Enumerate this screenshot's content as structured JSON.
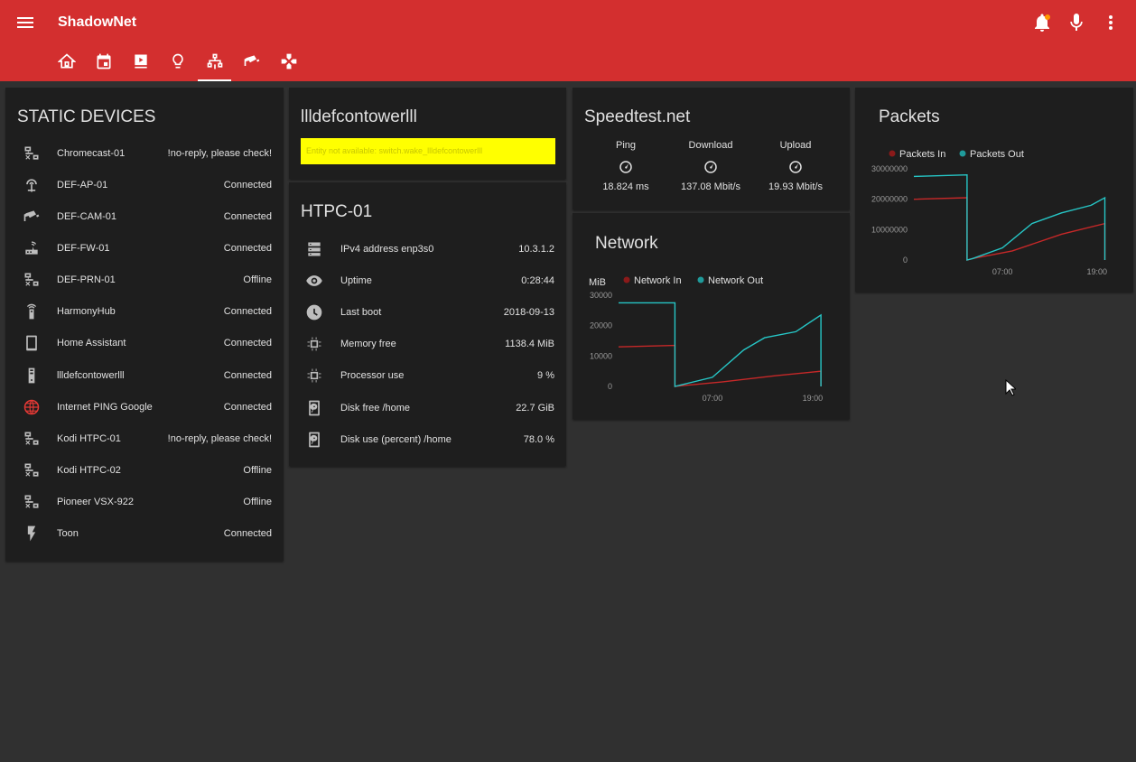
{
  "app": {
    "title": "ShadowNet"
  },
  "tabs": [
    "home-icon",
    "calendar-icon",
    "media-icon",
    "lightbulb-icon",
    "network-icon",
    "camera-icon",
    "gamepad-icon"
  ],
  "static_devices": {
    "title": "STATIC DEVICES",
    "items": [
      {
        "name": "Chromecast-01",
        "state": "!no-reply, please check!",
        "icon": "lan-disconnect-icon"
      },
      {
        "name": "DEF-AP-01",
        "state": "Connected",
        "icon": "access-point-icon"
      },
      {
        "name": "DEF-CAM-01",
        "state": "Connected",
        "icon": "cctv-icon"
      },
      {
        "name": "DEF-FW-01",
        "state": "Connected",
        "icon": "router-icon"
      },
      {
        "name": "DEF-PRN-01",
        "state": "Offline",
        "icon": "lan-disconnect-icon"
      },
      {
        "name": "HarmonyHub",
        "state": "Connected",
        "icon": "remote-icon"
      },
      {
        "name": "Home Assistant",
        "state": "Connected",
        "icon": "tablet-icon"
      },
      {
        "name": "llldefcontowerlll",
        "state": "Connected",
        "icon": "tower-pc-icon"
      },
      {
        "name": "Internet PING Google",
        "state": "Connected",
        "icon": "globe-icon"
      },
      {
        "name": "Kodi HTPC-01",
        "state": "!no-reply, please check!",
        "icon": "lan-disconnect-icon"
      },
      {
        "name": "Kodi HTPC-02",
        "state": "Offline",
        "icon": "lan-disconnect-icon"
      },
      {
        "name": "Pioneer VSX-922",
        "state": "Offline",
        "icon": "lan-disconnect-icon"
      },
      {
        "name": "Toon",
        "state": "Connected",
        "icon": "flash-icon"
      }
    ]
  },
  "tower": {
    "title": "llldefcontowerlll",
    "warning": "Entity not available: switch.wake_llldefcontowerlll"
  },
  "htpc": {
    "title": "HTPC-01",
    "items": [
      {
        "name": "IPv4 address enp3s0",
        "value": "10.3.1.2",
        "icon": "server-icon"
      },
      {
        "name": "Uptime",
        "value": "0:28:44",
        "icon": "eye-icon"
      },
      {
        "name": "Last boot",
        "value": "2018-09-13",
        "icon": "clock-icon"
      },
      {
        "name": "Memory free",
        "value": "1138.4 MiB",
        "icon": "chip-icon"
      },
      {
        "name": "Processor use",
        "value": "9 %",
        "icon": "chip-icon"
      },
      {
        "name": "Disk free /home",
        "value": "22.7 GiB",
        "icon": "harddisk-icon"
      },
      {
        "name": "Disk use (percent) /home",
        "value": "78.0 %",
        "icon": "harddisk-icon"
      }
    ]
  },
  "speedtest": {
    "title": "Speedtest.net",
    "cols": [
      {
        "label": "Ping",
        "value": "18.824 ms"
      },
      {
        "label": "Download",
        "value": "137.08 Mbit/s"
      },
      {
        "label": "Upload",
        "value": "19.93 Mbit/s"
      }
    ]
  },
  "network": {
    "title": "Network"
  },
  "packets": {
    "title": "Packets"
  },
  "colors": {
    "in": "#c62828",
    "out": "#26c6c6",
    "header": "#d32f2f"
  },
  "chart_data": [
    {
      "type": "line",
      "title": "Network",
      "ylabel": "MiB",
      "ylim": [
        0,
        30000
      ],
      "yticks": [
        "30000",
        "20000",
        "10000",
        "0"
      ],
      "xticks": [
        "07:00",
        "19:00"
      ],
      "series": [
        {
          "name": "Network In",
          "x": [
            0,
            0.27,
            0.27,
            0.3,
            0.5,
            0.75,
            0.97,
            0.97
          ],
          "y": [
            13000,
            13500,
            0,
            200,
            1500,
            3500,
            5000,
            0
          ]
        },
        {
          "name": "Network Out",
          "x": [
            0,
            0.27,
            0.27,
            0.3,
            0.45,
            0.6,
            0.7,
            0.85,
            0.97,
            0.97
          ],
          "y": [
            27500,
            27500,
            0,
            500,
            3000,
            12000,
            16000,
            18000,
            23500,
            0
          ]
        }
      ]
    },
    {
      "type": "line",
      "title": "Packets",
      "ylim": [
        0,
        30000000
      ],
      "yticks": [
        "30000000",
        "20000000",
        "10000000",
        "0"
      ],
      "xticks": [
        "07:00",
        "19:00"
      ],
      "series": [
        {
          "name": "Packets In",
          "x": [
            0,
            0.27,
            0.27,
            0.3,
            0.5,
            0.75,
            0.97,
            0.97
          ],
          "y": [
            20000000,
            20500000,
            0,
            500000,
            3000000,
            8500000,
            12000000,
            0
          ]
        },
        {
          "name": "Packets Out",
          "x": [
            0,
            0.27,
            0.27,
            0.3,
            0.45,
            0.6,
            0.75,
            0.9,
            0.97,
            0.97
          ],
          "y": [
            27500000,
            28000000,
            0,
            500000,
            4000000,
            12000000,
            15500000,
            18000000,
            20500000,
            0
          ]
        }
      ]
    }
  ]
}
